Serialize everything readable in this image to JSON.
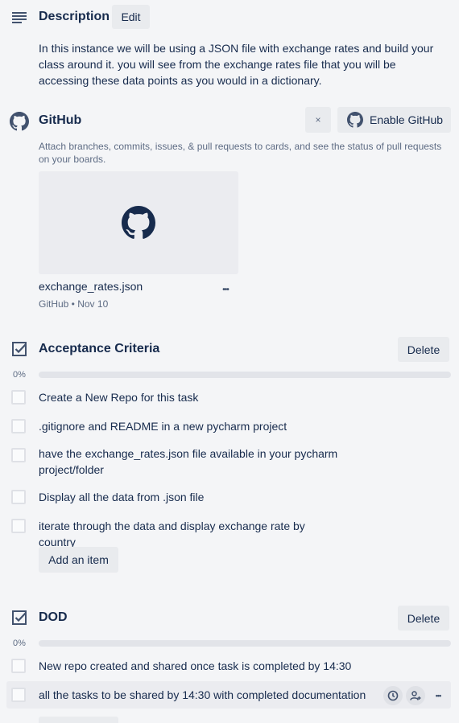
{
  "description": {
    "title": "Description",
    "edit_label": "Edit",
    "text": "In this instance we will be using a JSON file with exchange rates and build your class around it. you will see from the exchange rates file that you will be accessing these data points as you would in a dictionary."
  },
  "github": {
    "title": "GitHub",
    "close_label": "×",
    "enable_label": "Enable GitHub",
    "description": "Attach branches, commits, issues, & pull requests to cards, and see the status of pull requests on your boards.",
    "attachment": {
      "name": "exchange_rates.json",
      "meta": "GitHub • Nov 10",
      "menu_label": "•••"
    }
  },
  "acceptance": {
    "title": "Acceptance Criteria",
    "delete_label": "Delete",
    "progress_text": "0%",
    "progress": 0,
    "items": [
      {
        "label": "Create a New Repo for this task",
        "checked": false
      },
      {
        "label": ".gitignore and README in a new pycharm project",
        "checked": false
      },
      {
        "label": "have the exchange_rates.json file available in your pycharm project/folder",
        "checked": false
      },
      {
        "label": "Display all the data from .json file",
        "checked": false
      },
      {
        "label": "iterate through the data and display exchange rate by country",
        "checked": false
      }
    ],
    "add_label": "Add an item"
  },
  "dod": {
    "title": "DOD",
    "delete_label": "Delete",
    "progress_text": "0%",
    "progress": 0,
    "items": [
      {
        "label": "New repo created and shared once task is completed by 14:30",
        "checked": false
      },
      {
        "label": "all the tasks to be shared by 14:30 with completed documentation",
        "checked": false
      }
    ],
    "item_actions": [
      "clock-icon",
      "assign-member-icon",
      "more-icon"
    ]
  },
  "colors": {
    "background": "#f4f5f7",
    "button": "#e9ebee",
    "text": "#172b4d",
    "muted": "#5e6c84",
    "progress_track": "#e2e4e9"
  }
}
